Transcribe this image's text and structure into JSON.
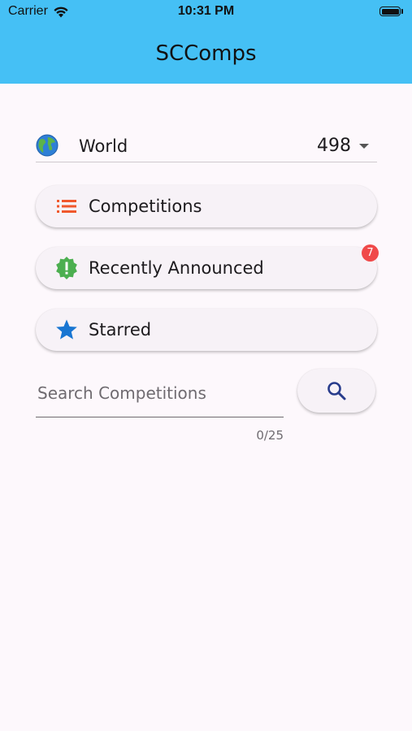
{
  "status_bar": {
    "carrier": "Carrier",
    "time": "10:31 PM"
  },
  "app_bar": {
    "title": "SCComps"
  },
  "region": {
    "name": "World",
    "count": "498"
  },
  "menu": [
    {
      "label": "Competitions",
      "icon": "list-icon",
      "color": "#f0582c"
    },
    {
      "label": "Recently Announced",
      "icon": "new-releases-icon",
      "color": "#4caf50",
      "badge": "7"
    },
    {
      "label": "Starred",
      "icon": "star-icon",
      "color": "#1976d2"
    }
  ],
  "search": {
    "placeholder": "Search Competitions",
    "value": "",
    "counter": "0/25"
  },
  "colors": {
    "app_bar": "#45c0f5",
    "background": "#fdf8fc",
    "badge": "#f04a4a",
    "search_icon": "#283c8c"
  }
}
